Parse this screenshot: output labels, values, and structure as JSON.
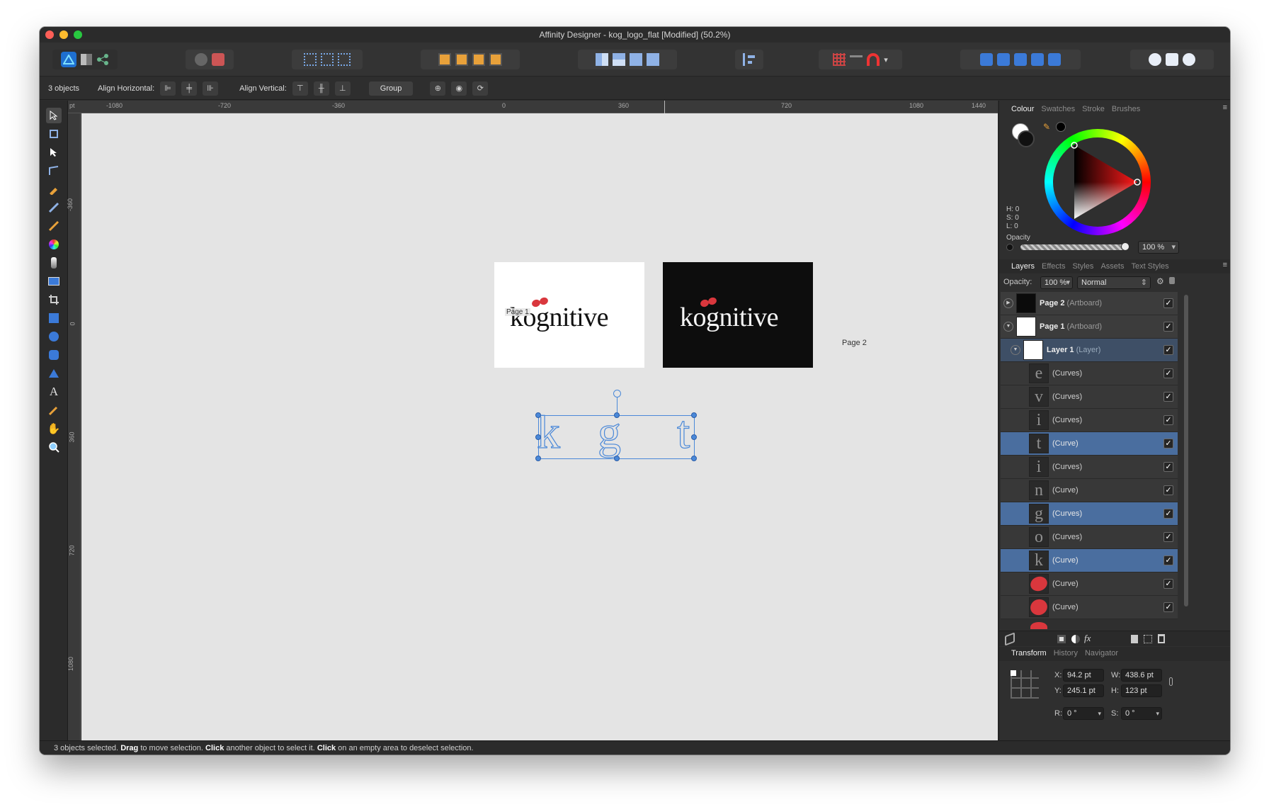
{
  "window": {
    "title": "Affinity Designer - kog_logo_flat [Modified] (50.2%)"
  },
  "colors": {
    "accent": "#4a6e9f",
    "brand_red": "#d9373d",
    "selection": "#4a88d8"
  },
  "toolbar": {
    "persona_icons": [
      "designer-persona-icon",
      "pixel-persona-icon",
      "export-persona-icon"
    ],
    "snapping_label": "▾"
  },
  "context": {
    "objects": "3 objects",
    "align_h": "Align Horizontal:",
    "align_v": "Align Vertical:",
    "group": "Group"
  },
  "ruler": {
    "unit": "pt",
    "top_ticks": [
      "-1080",
      "-720",
      "-360",
      "0",
      "360",
      "720",
      "1080",
      "1440"
    ],
    "left_ticks": [
      "-360",
      "0",
      "360",
      "720",
      "1080"
    ]
  },
  "canvas": {
    "artboard1_label": "Page 1",
    "artboard2_label": "Page 2",
    "logo_text": "kognitive",
    "sel_letters": [
      "k",
      "g",
      "t"
    ]
  },
  "colour_panel": {
    "tabs": [
      "Colour",
      "Swatches",
      "Stroke",
      "Brushes"
    ],
    "h": "H: 0",
    "s": "S: 0",
    "l": "L: 0",
    "opacity_label": "Opacity",
    "opacity_value": "100 %"
  },
  "layers_panel": {
    "tabs": [
      "Layers",
      "Effects",
      "Styles",
      "Assets",
      "Text Styles"
    ],
    "opacity_label": "Opacity:",
    "opacity_value": "100 %",
    "blend": "Normal",
    "rows": [
      {
        "name": "Page 2",
        "type": "(Artboard)"
      },
      {
        "name": "Page 1",
        "type": "(Artboard)"
      },
      {
        "name": "Layer 1",
        "type": "(Layer)"
      },
      {
        "glyph": "e",
        "label": "(Curves)"
      },
      {
        "glyph": "v",
        "label": "(Curves)"
      },
      {
        "glyph": "i",
        "label": "(Curves)"
      },
      {
        "glyph": "t",
        "label": "(Curve)"
      },
      {
        "glyph": "i",
        "label": "(Curves)"
      },
      {
        "glyph": "n",
        "label": "(Curve)"
      },
      {
        "glyph": "g",
        "label": "(Curves)"
      },
      {
        "glyph": "o",
        "label": "(Curves)"
      },
      {
        "glyph": "k",
        "label": "(Curve)"
      },
      {
        "glyph": "",
        "label": "(Curve)"
      },
      {
        "glyph": "",
        "label": "(Curve)"
      }
    ]
  },
  "transform_panel": {
    "tabs": [
      "Transform",
      "History",
      "Navigator"
    ],
    "x_label": "X:",
    "x": "94.2 pt",
    "y_label": "Y:",
    "y": "245.1 pt",
    "w_label": "W:",
    "w": "438.6 pt",
    "h_label": "H:",
    "h": "123 pt",
    "r_label": "R:",
    "r": "0 °",
    "s_label": "S:",
    "s": "0 °"
  },
  "status": {
    "count": "3 objects selected.",
    "drag": "Drag",
    "drag_text": "to move selection.",
    "click1": "Click",
    "click1_text": "another object to select it.",
    "click2": "Click",
    "click2_text": "on an empty area to deselect selection."
  }
}
